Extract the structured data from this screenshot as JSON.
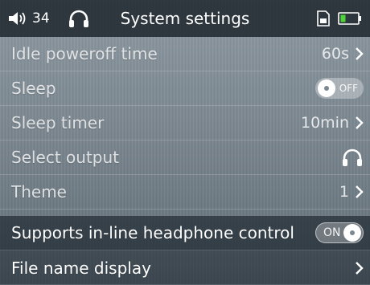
{
  "status_bar": {
    "volume_icon": "speaker-icon",
    "volume_level": "34",
    "headphone_icon": "headphone-icon",
    "title": "System settings",
    "sd_card_icon": "sd-card-icon",
    "battery_icon": "battery-icon"
  },
  "settings": {
    "idle_poweroff": {
      "label": "Idle poweroff time",
      "value": "60s"
    },
    "sleep": {
      "label": "Sleep",
      "toggle": "OFF"
    },
    "sleep_timer": {
      "label": "Sleep timer",
      "value": "10min"
    },
    "select_output": {
      "label": "Select output",
      "icon": "headphone-icon"
    },
    "theme": {
      "label": "Theme",
      "value": "1"
    },
    "inline_control": {
      "label": "Supports in-line headphone control",
      "toggle": "ON"
    },
    "file_name_display": {
      "label": "File name display"
    }
  },
  "colors": {
    "status_bar_bg": "#1c252b",
    "battery_fill": "#4fd13a"
  }
}
